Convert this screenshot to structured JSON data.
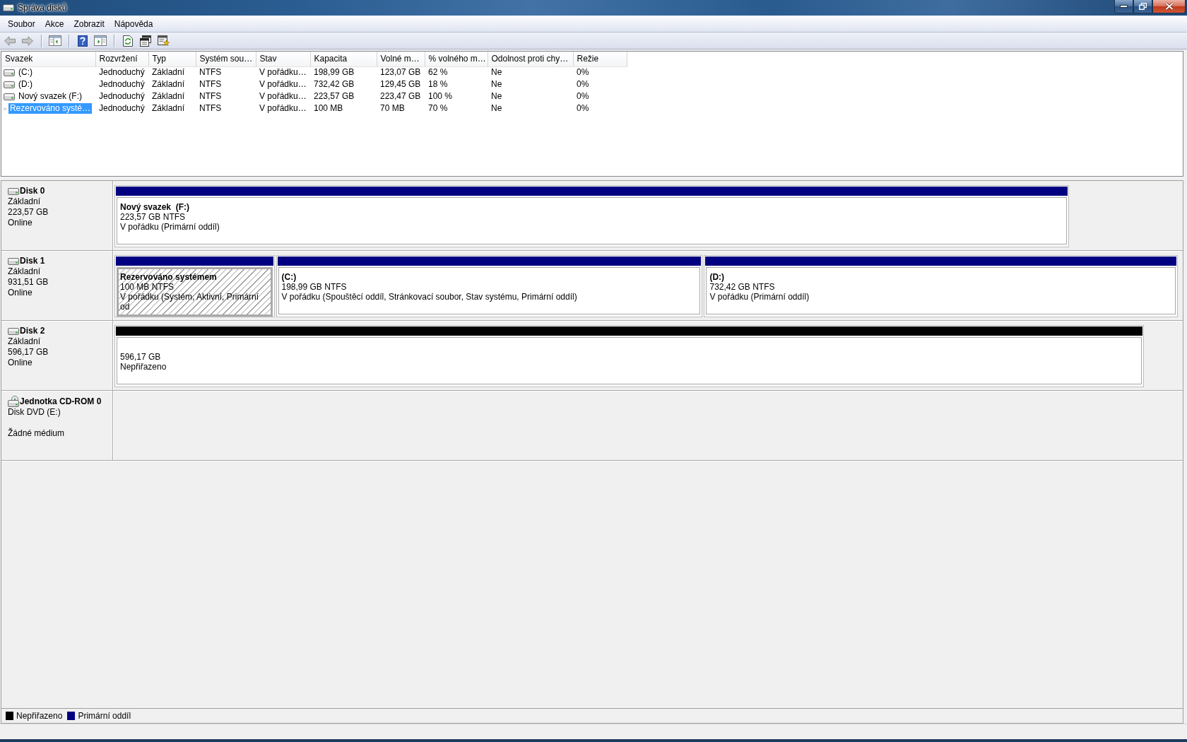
{
  "window": {
    "title": "Správa disků"
  },
  "menu": [
    {
      "label": "Soubor"
    },
    {
      "label": "Akce"
    },
    {
      "label": "Zobrazit"
    },
    {
      "label": "Nápověda"
    }
  ],
  "toolbar": [
    {
      "items": [
        {
          "kind": "back",
          "disabled": true
        },
        {
          "kind": "forward",
          "disabled": true
        }
      ]
    },
    {
      "items": [
        {
          "kind": "tree-pane",
          "disabled": false
        }
      ]
    },
    {
      "items": [
        {
          "kind": "help",
          "disabled": false
        },
        {
          "kind": "action-pane",
          "disabled": false
        }
      ]
    },
    {
      "items": [
        {
          "kind": "refresh",
          "disabled": false
        },
        {
          "kind": "properties",
          "disabled": false
        },
        {
          "kind": "wizard",
          "disabled": false
        }
      ]
    }
  ],
  "volumes": {
    "columns": [
      "Svazek",
      "Rozvržení",
      "Typ",
      "Systém sou…",
      "Stav",
      "Kapacita",
      "Volné m…",
      "% volného m…",
      "Odolnost proti chy…",
      "Režie"
    ],
    "rows": [
      {
        "selected": false,
        "cells": [
          "(C:)",
          "Jednoduchý",
          "Základní",
          "NTFS",
          "V pořádku…",
          "198,99 GB",
          "123,07 GB",
          "62 %",
          "Ne",
          "0%"
        ]
      },
      {
        "selected": false,
        "cells": [
          "(D:)",
          "Jednoduchý",
          "Základní",
          "NTFS",
          "V pořádku…",
          "732,42 GB",
          "129,45 GB",
          "18 %",
          "Ne",
          "0%"
        ]
      },
      {
        "selected": false,
        "cells": [
          "Nový svazek (F:)",
          "Jednoduchý",
          "Základní",
          "NTFS",
          "V pořádku…",
          "223,57 GB",
          "223,47 GB",
          "100 %",
          "Ne",
          "0%"
        ]
      },
      {
        "selected": true,
        "cells": [
          "Rezervováno systé…",
          "Jednoduchý",
          "Základní",
          "NTFS",
          "V pořádku…",
          "100 MB",
          "70 MB",
          "70 %",
          "Ne",
          "0%"
        ]
      }
    ]
  },
  "disks": [
    {
      "kind": "hdd",
      "name": "Disk 0",
      "type": "Základní",
      "size": "223,57 GB",
      "status": "Online",
      "partitions": [
        {
          "kind": "volume",
          "title": "Nový svazek  (F:)",
          "size": "223,57 GB NTFS",
          "status": "V pořádku (Primární oddíl)",
          "color": "#000080",
          "selected": false
        }
      ]
    },
    {
      "kind": "hdd",
      "name": "Disk 1",
      "type": "Základní",
      "size": "931,51 GB",
      "status": "Online",
      "partitions": [
        {
          "kind": "volume",
          "title": "Rezervováno systémem",
          "size": "100 MB NTFS",
          "status": "V pořádku (Systém, Aktivní, Primární od",
          "color": "#000080",
          "selected": true
        },
        {
          "kind": "volume",
          "title": "(C:)",
          "size": "198,99 GB NTFS",
          "status": "V pořádku (Spouštěcí oddíl, Stránkovací soubor, Stav systému, Primární oddíl)",
          "color": "#000080",
          "selected": false
        },
        {
          "kind": "volume",
          "title": "(D:)",
          "size": "732,42 GB NTFS",
          "status": "V pořádku (Primární oddíl)",
          "color": "#000080",
          "selected": false
        }
      ]
    },
    {
      "kind": "hdd",
      "name": "Disk 2",
      "type": "Základní",
      "size": "596,17 GB",
      "status": "Online",
      "partitions": [
        {
          "kind": "unallocated",
          "size": "596,17 GB",
          "status": "Nepřiřazeno",
          "color": "#000000",
          "selected": false
        }
      ]
    },
    {
      "kind": "cdrom",
      "name": "Jednotka CD-ROM 0",
      "type": "Disk DVD (E:)",
      "status": "Žádné médium"
    }
  ],
  "legend": [
    {
      "label": "Nepřiřazeno",
      "color": "#000000"
    },
    {
      "label": "Primární oddíl",
      "color": "#000080"
    }
  ]
}
